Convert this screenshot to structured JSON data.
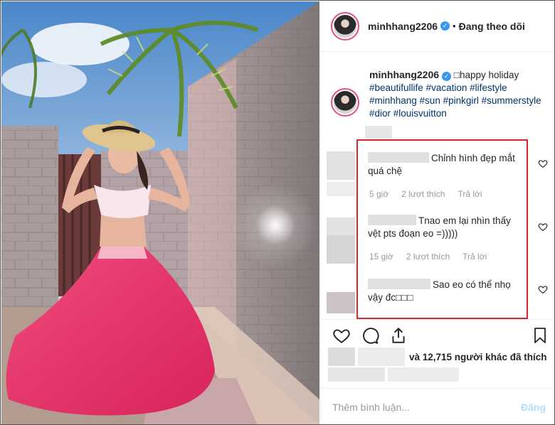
{
  "post": {
    "username": "minhhang2206",
    "follow_status": "Đang theo dõi",
    "dot": "•",
    "caption_text": "□happy holiday",
    "hashtags": "#beautifullife #vacation #lifestyle #minhhang #sun #pinkgirl #summerstyle #dior #louisvuitton"
  },
  "comments": [
    {
      "text": "Chỉnh hình đẹp mắt quá chệ",
      "time": "5 giờ",
      "likes": "2 lượt thích",
      "reply": "Trả lời"
    },
    {
      "text": "Tnao em lại nhìn thấy vệt pts đoạn eo =)))))",
      "time": "15 giờ",
      "likes": "2 lượt thích",
      "reply": "Trả lời"
    },
    {
      "text": "Sao eo có thể nhọ vậy đc□□□"
    }
  ],
  "likes_text": "và 12,715 người khác đã thích",
  "comment_input": {
    "placeholder": "Thêm bình luận...",
    "value": ""
  },
  "post_button": "Đăng",
  "colors": {
    "highlight_border": "#d6262e",
    "hashtag": "#003569",
    "verified": "#3897f0",
    "post_button_disabled": "#b2dffc",
    "skirt": "#e0316a"
  },
  "icons": [
    "verified-badge-icon",
    "heart-icon",
    "comment-icon",
    "share-icon",
    "bookmark-icon"
  ]
}
